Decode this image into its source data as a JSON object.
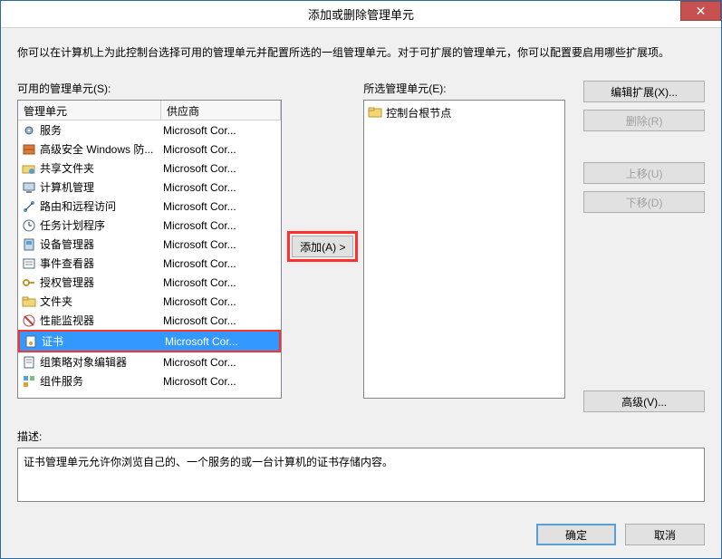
{
  "window": {
    "title": "添加或删除管理单元",
    "description": "你可以在计算机上为此控制台选择可用的管理单元并配置所选的一组管理单元。对于可扩展的管理单元，你可以配置要启用哪些扩展项。"
  },
  "available": {
    "label": "可用的管理单元(S):",
    "header_name": "管理单元",
    "header_vendor": "供应商",
    "items": [
      {
        "name": "服务",
        "vendor": "Microsoft Cor...",
        "icon": "gear"
      },
      {
        "name": "高级安全 Windows 防...",
        "vendor": "Microsoft Cor...",
        "icon": "firewall"
      },
      {
        "name": "共享文件夹",
        "vendor": "Microsoft Cor...",
        "icon": "folder-share"
      },
      {
        "name": "计算机管理",
        "vendor": "Microsoft Cor...",
        "icon": "computer"
      },
      {
        "name": "路由和远程访问",
        "vendor": "Microsoft Cor...",
        "icon": "network"
      },
      {
        "name": "任务计划程序",
        "vendor": "Microsoft Cor...",
        "icon": "clock"
      },
      {
        "name": "设备管理器",
        "vendor": "Microsoft Cor...",
        "icon": "device"
      },
      {
        "name": "事件查看器",
        "vendor": "Microsoft Cor...",
        "icon": "event"
      },
      {
        "name": "授权管理器",
        "vendor": "Microsoft Cor...",
        "icon": "key"
      },
      {
        "name": "文件夹",
        "vendor": "Microsoft Cor...",
        "icon": "folder"
      },
      {
        "name": "性能监视器",
        "vendor": "Microsoft Cor...",
        "icon": "perf"
      },
      {
        "name": "证书",
        "vendor": "Microsoft Cor...",
        "icon": "cert",
        "selected": true,
        "highlighted": true
      },
      {
        "name": "组策略对象编辑器",
        "vendor": "Microsoft Cor...",
        "icon": "policy"
      },
      {
        "name": "组件服务",
        "vendor": "Microsoft Cor...",
        "icon": "component"
      }
    ]
  },
  "add_button": "添加(A) >",
  "selected": {
    "label": "所选管理单元(E):",
    "root": "控制台根节点"
  },
  "side_buttons": {
    "edit_ext": "编辑扩展(X)...",
    "remove": "删除(R)",
    "move_up": "上移(U)",
    "move_down": "下移(D)",
    "advanced": "高级(V)..."
  },
  "description": {
    "label": "描述:",
    "text": "证书管理单元允许你浏览自己的、一个服务的或一台计算机的证书存储内容。"
  },
  "bottom": {
    "ok": "确定",
    "cancel": "取消"
  }
}
